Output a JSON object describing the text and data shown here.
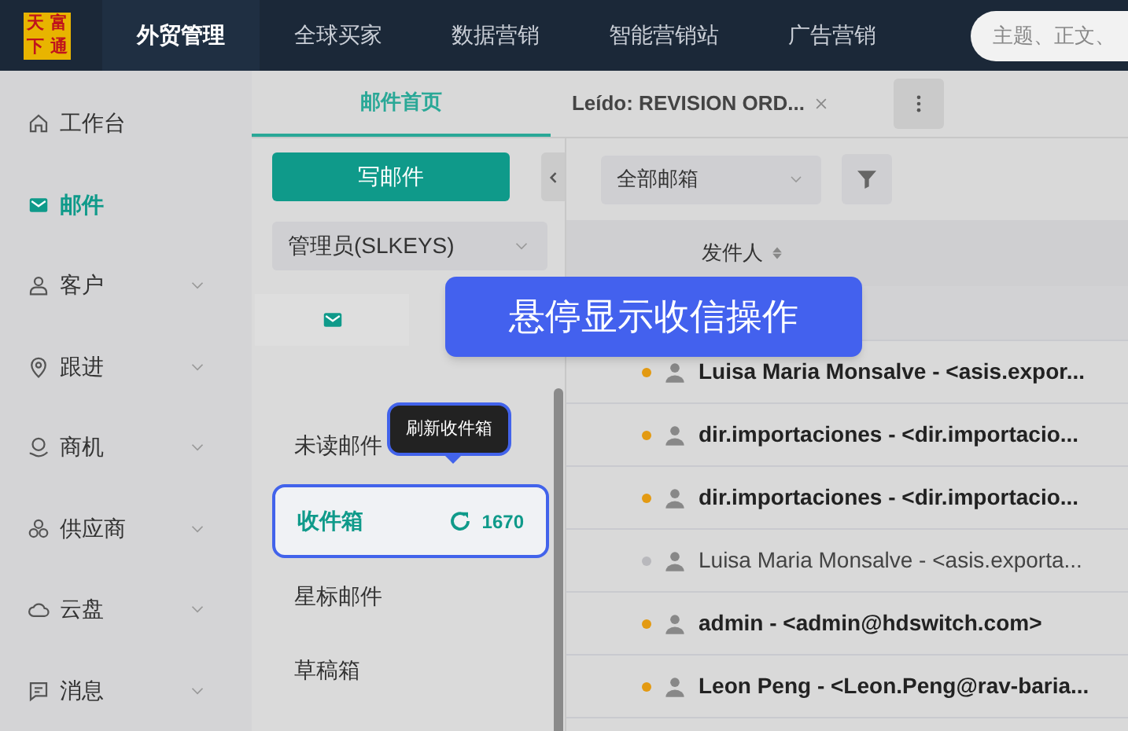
{
  "top_nav": {
    "logo": [
      "天",
      "富",
      "下",
      "通"
    ],
    "items": [
      {
        "label": "外贸管理",
        "selected": true
      },
      {
        "label": "全球买家",
        "selected": false
      },
      {
        "label": "数据营销",
        "selected": false
      },
      {
        "label": "智能营销站",
        "selected": false
      },
      {
        "label": "广告营销",
        "selected": false
      }
    ],
    "search": {
      "placeholder": "主题、正文、"
    }
  },
  "sidebar": {
    "items": [
      {
        "label": "工作台",
        "selected": false,
        "expandable": false
      },
      {
        "label": "邮件",
        "selected": true,
        "expandable": false
      },
      {
        "label": "客户",
        "selected": false,
        "expandable": true
      },
      {
        "label": "跟进",
        "selected": false,
        "expandable": true
      },
      {
        "label": "商机",
        "selected": false,
        "expandable": true
      },
      {
        "label": "供应商",
        "selected": false,
        "expandable": true
      },
      {
        "label": "云盘",
        "selected": false,
        "expandable": true
      },
      {
        "label": "消息",
        "selected": false,
        "expandable": true
      }
    ]
  },
  "tabs": [
    {
      "label": "邮件首页",
      "selected": true,
      "closable": false
    },
    {
      "label": "Leído: REVISION ORD...",
      "selected": false,
      "closable": true
    }
  ],
  "mail_panel": {
    "compose": "写邮件",
    "account": "管理员(SLKEYS)",
    "folders": [
      {
        "label": "未读邮件",
        "selected": false
      },
      {
        "label": "收件箱",
        "selected": true,
        "count": "1670"
      },
      {
        "label": "星标邮件",
        "selected": false
      },
      {
        "label": "草稿箱",
        "selected": false
      }
    ],
    "tooltip": "刷新收件箱"
  },
  "list": {
    "filter": "全部邮箱",
    "column": "发件人",
    "rows": [
      {
        "sender": "Luisa Maria Monsalve - <asis.expor...",
        "unread": true
      },
      {
        "sender": "dir.importaciones - <dir.importacio...",
        "unread": true
      },
      {
        "sender": "dir.importaciones - <dir.importacio...",
        "unread": true
      },
      {
        "sender": "Luisa Maria Monsalve - <asis.exporta...",
        "unread": false
      },
      {
        "sender": "admin - <admin@hdswitch.com>",
        "unread": true
      },
      {
        "sender": "Leon Peng - <Leon.Peng@rav-baria...",
        "unread": true
      }
    ]
  },
  "banner": "悬停显示收信操作"
}
